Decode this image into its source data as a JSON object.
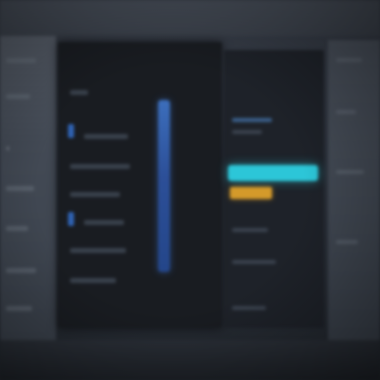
{
  "theme": {
    "accent_blue": "#2f63b4",
    "accent_cyan": "#2cc6d8",
    "accent_orange": "#d49a2a",
    "panel_dark": "#191c21"
  },
  "icons": {
    "sidebar_glyph": "chevron-icon"
  },
  "sidebar": {
    "glyph": "‹"
  },
  "main": {
    "heading": ""
  },
  "inspector": {
    "heading": ""
  }
}
